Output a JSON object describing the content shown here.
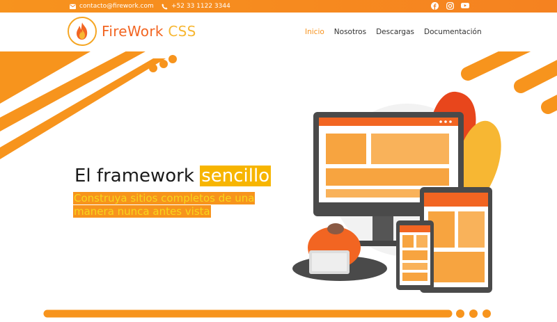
{
  "topbar": {
    "email": "contacto@firework.com",
    "phone": "+52 33 1122 3344",
    "icons": [
      "envelope-icon",
      "phone-icon",
      "facebook-icon",
      "instagram-icon",
      "youtube-icon"
    ]
  },
  "brand": {
    "name_main": "FireWork",
    "name_accent": "CSS",
    "logo_icon": "flame-icon"
  },
  "nav": {
    "items": [
      {
        "label": "Inicio",
        "active": true
      },
      {
        "label": "Nosotros",
        "active": false
      },
      {
        "label": "Descargas",
        "active": false
      },
      {
        "label": "Documentación",
        "active": false
      }
    ]
  },
  "hero": {
    "title_prefix": "El framework",
    "title_highlight": "sencillo",
    "subtitle_line1": "Construya sitios completos de una",
    "subtitle_line2": "manera nunca antes vista"
  },
  "colors": {
    "primary": "#f7931e",
    "accent": "#f26522",
    "highlight": "#f7b500",
    "subtitle_text": "#f7d51d"
  }
}
